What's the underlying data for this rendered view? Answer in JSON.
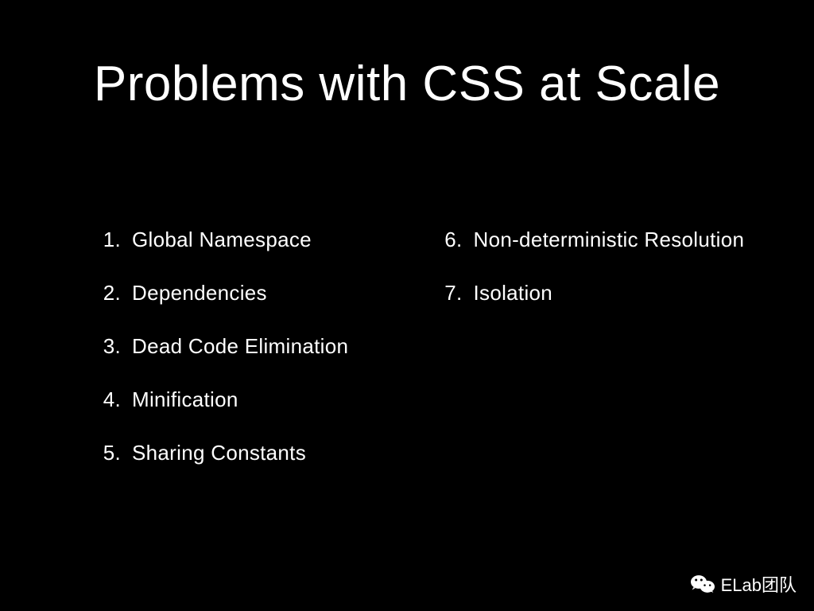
{
  "title": "Problems with CSS at Scale",
  "leftColumn": [
    {
      "num": "1.",
      "text": "Global Namespace"
    },
    {
      "num": "2.",
      "text": "Dependencies"
    },
    {
      "num": "3.",
      "text": "Dead Code Elimination"
    },
    {
      "num": "4.",
      "text": "Minification"
    },
    {
      "num": "5.",
      "text": "Sharing Constants"
    }
  ],
  "rightColumn": [
    {
      "num": "6.",
      "text": "Non-deterministic Resolution"
    },
    {
      "num": "7.",
      "text": "Isolation"
    }
  ],
  "watermark": {
    "label": "ELab团队"
  }
}
